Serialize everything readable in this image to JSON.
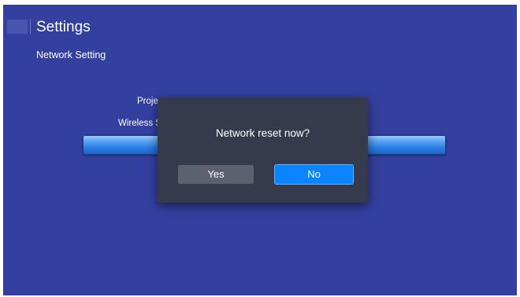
{
  "header": {
    "title": "Settings",
    "icon": "settings-app-icon"
  },
  "subtitle": "Network Setting",
  "list": {
    "items": [
      {
        "label": "Proje"
      },
      {
        "label": "Wireless S"
      }
    ]
  },
  "dialog": {
    "message": "Network reset now?",
    "yes_label": "Yes",
    "no_label": "No",
    "focused_button": "No"
  },
  "colors": {
    "background": "#3340a0",
    "dialog_background": "#353a4c",
    "focus_accent": "#0a84ff",
    "secondary_button": "#5d606d"
  }
}
